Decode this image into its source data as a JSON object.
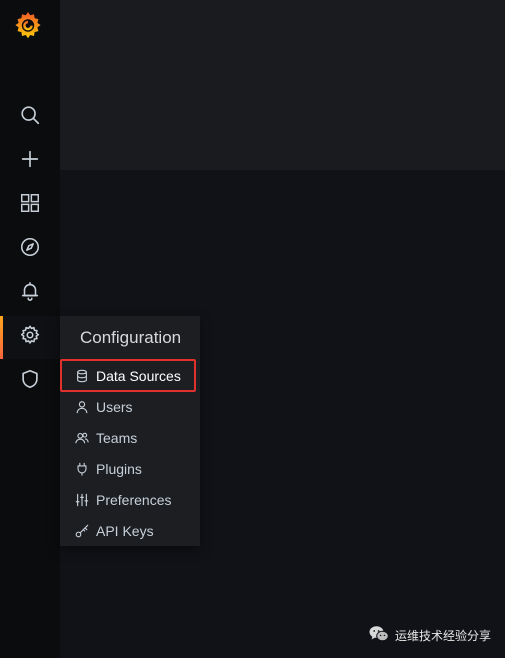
{
  "sidebar": {
    "logo": "grafana-logo",
    "items": [
      {
        "icon": "search-icon"
      },
      {
        "icon": "plus-icon"
      },
      {
        "icon": "dashboards-grid-icon"
      },
      {
        "icon": "compass-icon"
      },
      {
        "icon": "bell-icon"
      },
      {
        "icon": "gear-icon",
        "active": true
      },
      {
        "icon": "shield-icon"
      }
    ]
  },
  "configuration_menu": {
    "title": "Configuration",
    "items": [
      {
        "label": "Data Sources",
        "icon": "database-icon",
        "highlighted": true
      },
      {
        "label": "Users",
        "icon": "user-icon"
      },
      {
        "label": "Teams",
        "icon": "users-icon"
      },
      {
        "label": "Plugins",
        "icon": "plug-icon"
      },
      {
        "label": "Preferences",
        "icon": "sliders-icon"
      },
      {
        "label": "API Keys",
        "icon": "key-icon"
      }
    ]
  },
  "watermark": {
    "text": "运维技术经验分享",
    "icon": "wechat-icon"
  },
  "colors": {
    "accent": "#f7663b",
    "highlight_border": "#e0312d",
    "sidebar_bg": "#0b0c0e",
    "flyout_bg": "#1c1e22"
  }
}
